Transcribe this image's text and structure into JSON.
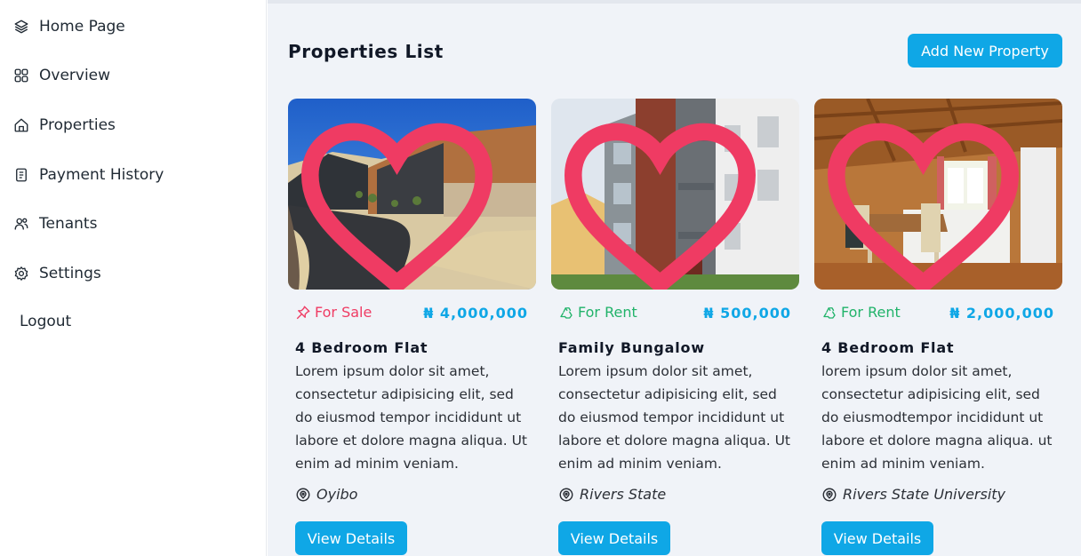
{
  "sidebar": {
    "items": [
      {
        "label": "Home Page",
        "icon": "layers-icon"
      },
      {
        "label": "Overview",
        "icon": "grid-icon"
      },
      {
        "label": "Properties",
        "icon": "house-icon"
      },
      {
        "label": "Payment History",
        "icon": "document-icon"
      },
      {
        "label": "Tenants",
        "icon": "users-icon"
      },
      {
        "label": "Settings",
        "icon": "gear-icon"
      }
    ],
    "logout": "Logout"
  },
  "main": {
    "title": "Properties List",
    "add_button": "Add New Property",
    "accent_color": "#0fa7e6",
    "sale_color": "#ef3b63",
    "rent_color": "#21b36a",
    "cards": [
      {
        "status": "For Sale",
        "status_icon": "pin-icon",
        "price": "₦ 4,000,000",
        "title": "4 Bedroom Flat",
        "description": "Lorem ipsum dolor sit amet, consectetur adipisicing elit, sed do eiusmod tempor incididunt ut labore et dolore magna aliqua. Ut enim ad minim veniam.",
        "location": "Oyibo",
        "button": "View Details"
      },
      {
        "status": "For Rent",
        "status_icon": "recycle-icon",
        "price": "₦ 500,000",
        "title": "Family Bungalow",
        "description": "Lorem ipsum dolor sit amet, consectetur adipisicing elit, sed do eiusmod tempor incididunt ut labore et dolore magna aliqua. Ut enim ad minim veniam.",
        "location": "Rivers State",
        "button": "View Details"
      },
      {
        "status": "For Rent",
        "status_icon": "recycle-icon",
        "price": "₦ 2,000,000",
        "title": "4 Bedroom Flat",
        "description": "lorem ipsum dolor sit amet, consectetur adipisicing elit, sed do eiusmodtempor incididunt ut labore et dolore magna aliqua. ut enim ad minim veniam.",
        "location": "Rivers State University",
        "button": "View Details"
      }
    ]
  }
}
